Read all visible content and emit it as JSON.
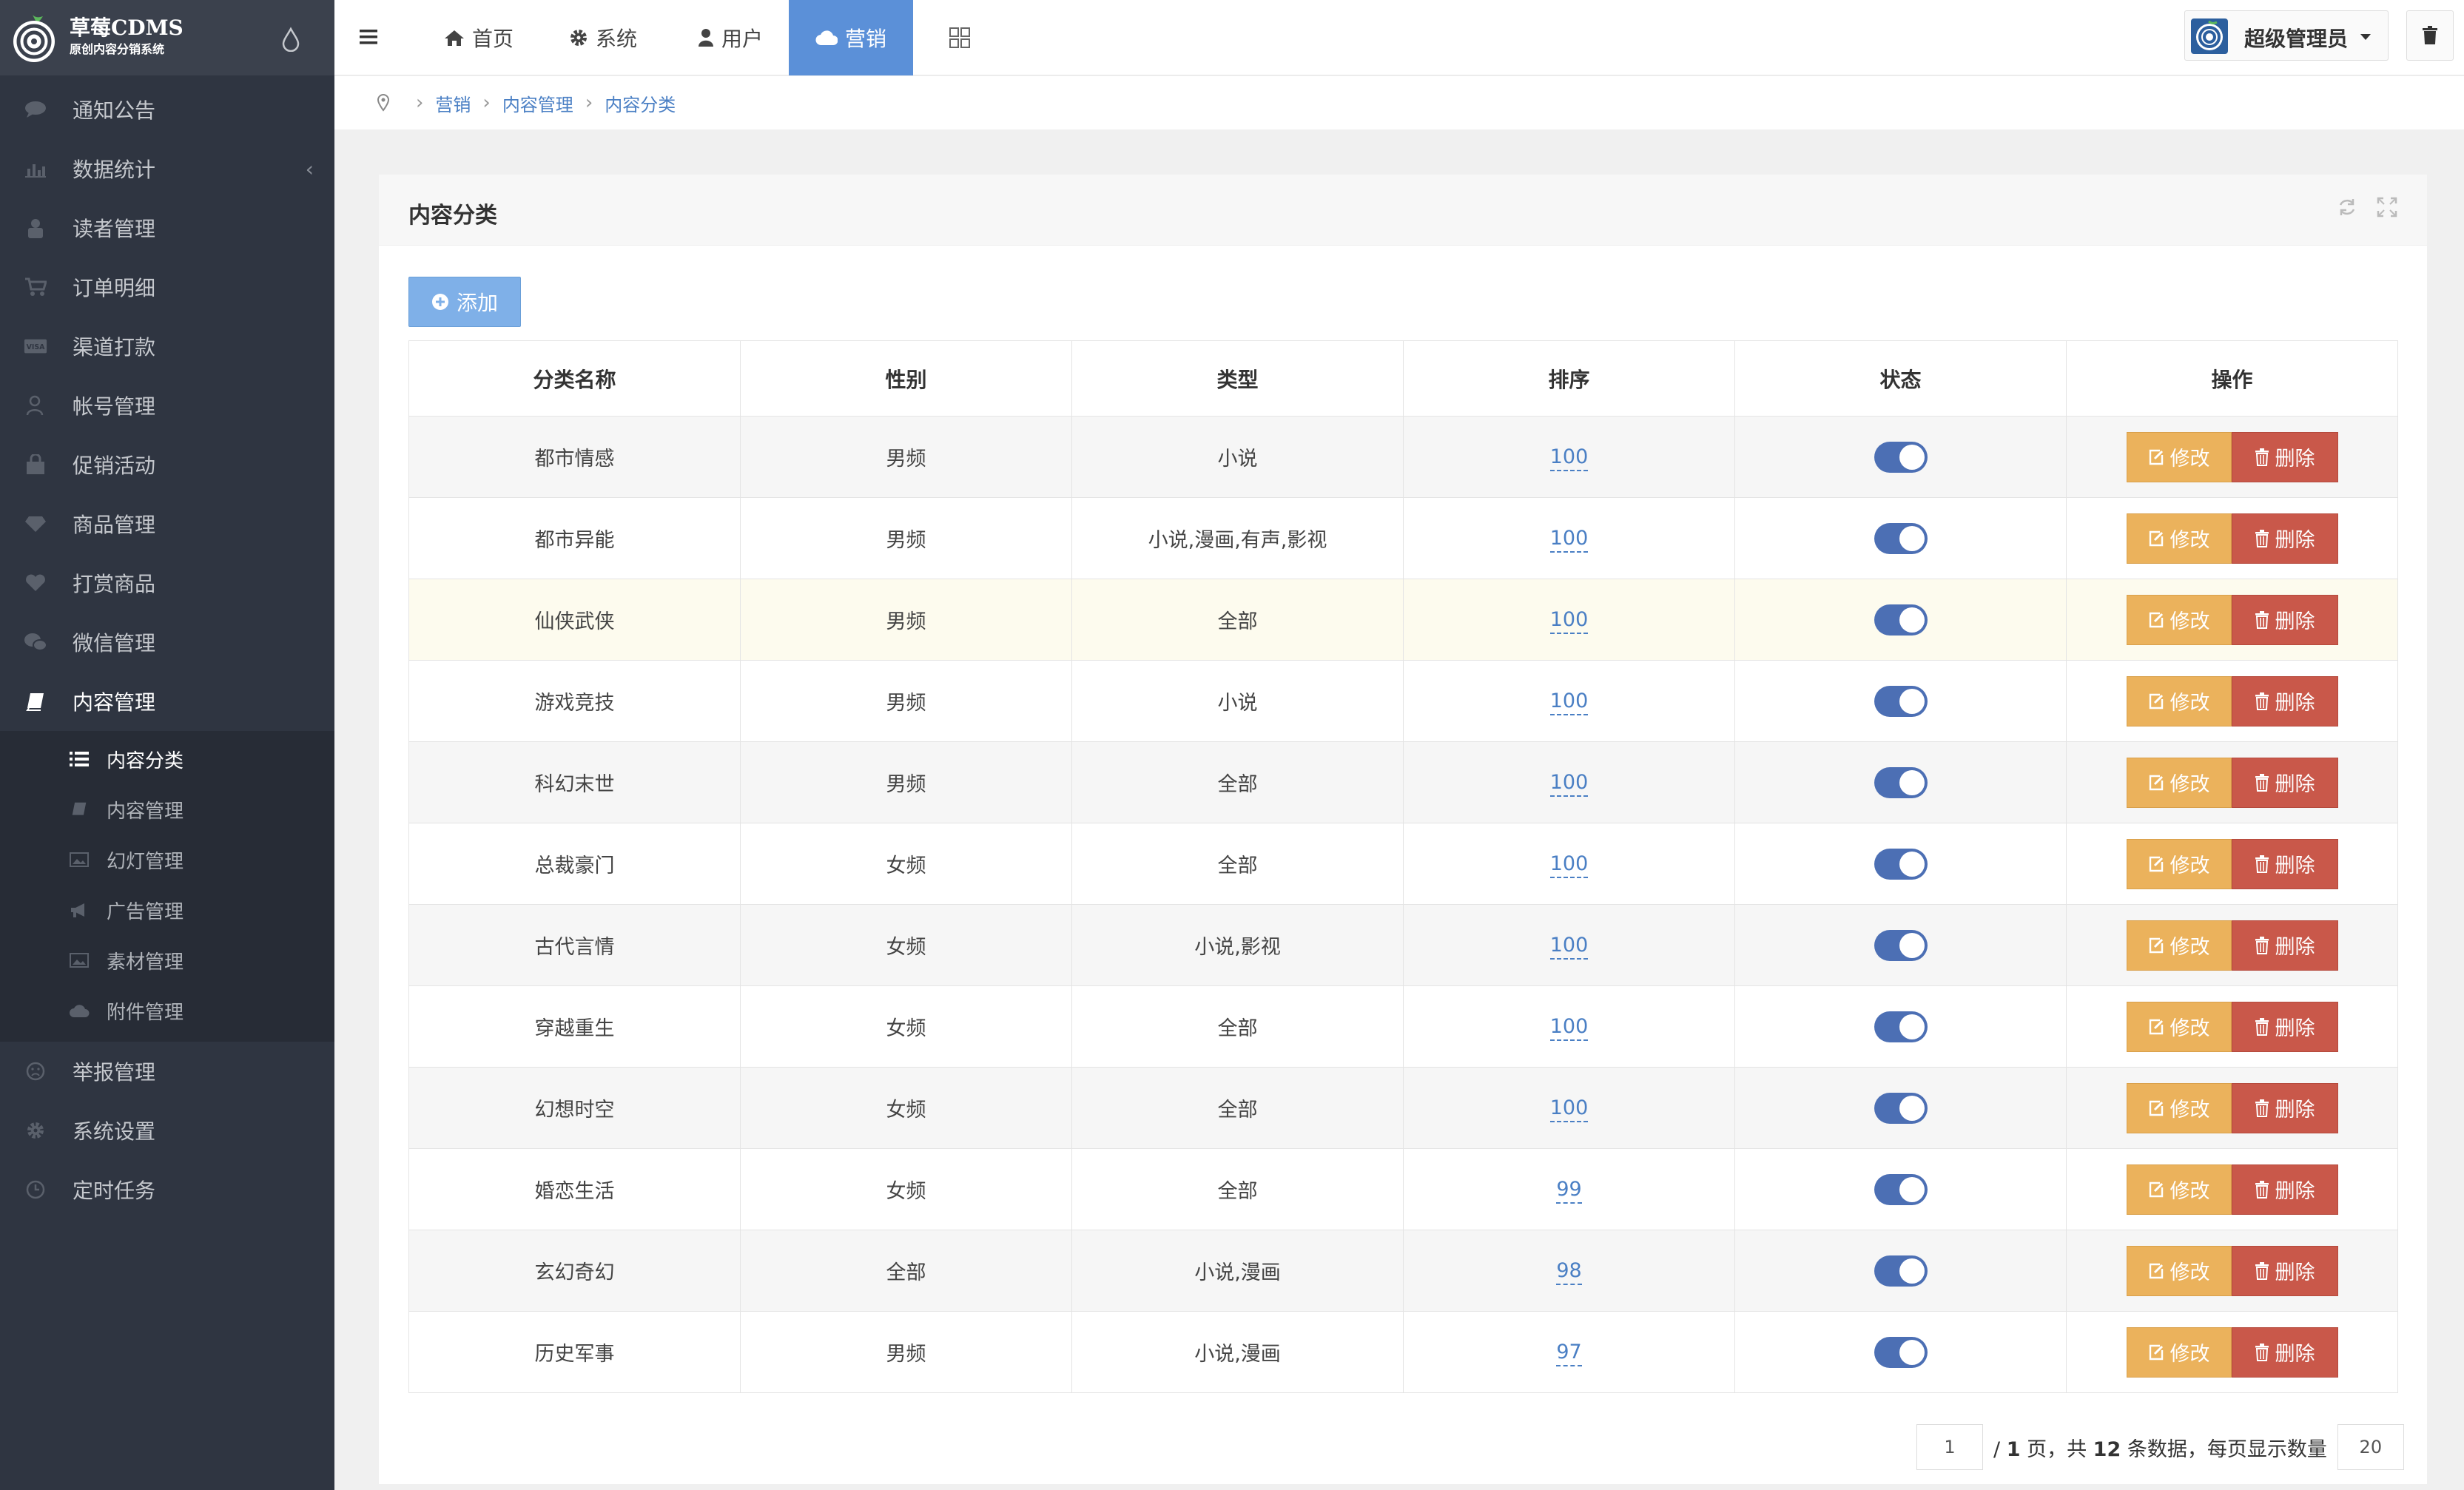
{
  "app": {
    "logo_title": "草莓CDMS",
    "logo_subtitle": "原创内容分销系统"
  },
  "sidebar": {
    "items": [
      {
        "label": "通知公告",
        "icon": "comment-icon"
      },
      {
        "label": "数据统计",
        "icon": "bar-chart-icon",
        "arrow": "‹"
      },
      {
        "label": "读者管理",
        "icon": "user-lock-icon"
      },
      {
        "label": "订单明细",
        "icon": "cart-icon"
      },
      {
        "label": "渠道打款",
        "icon": "visa-card-icon"
      },
      {
        "label": "帐号管理",
        "icon": "user-icon"
      },
      {
        "label": "促销活动",
        "icon": "bag-icon"
      },
      {
        "label": "商品管理",
        "icon": "diamond-icon"
      },
      {
        "label": "打赏商品",
        "icon": "heart-icon"
      },
      {
        "label": "微信管理",
        "icon": "wechat-icon"
      },
      {
        "label": "内容管理",
        "icon": "book-icon"
      }
    ],
    "sub_items": [
      {
        "label": "内容分类",
        "icon": "list-icon"
      },
      {
        "label": "内容管理",
        "icon": "book-icon"
      },
      {
        "label": "幻灯管理",
        "icon": "image-icon"
      },
      {
        "label": "广告管理",
        "icon": "bullhorn-icon"
      },
      {
        "label": "素材管理",
        "icon": "image-icon"
      },
      {
        "label": "附件管理",
        "icon": "cloud-upload-icon"
      }
    ],
    "bottom_items": [
      {
        "label": "举报管理",
        "icon": "frown-icon"
      },
      {
        "label": "系统设置",
        "icon": "gear-icon"
      },
      {
        "label": "定时任务",
        "icon": "clock-icon"
      }
    ]
  },
  "topnav": {
    "tabs": [
      {
        "label": "首页",
        "icon": "home-icon"
      },
      {
        "label": "系统",
        "icon": "gear-icon"
      },
      {
        "label": "用户",
        "icon": "user-icon"
      },
      {
        "label": "营销",
        "icon": "cloud-icon",
        "active": true
      }
    ],
    "admin_name": "超级管理员"
  },
  "breadcrumb": [
    "营销",
    "内容管理",
    "内容分类"
  ],
  "panel": {
    "title": "内容分类",
    "add_label": "添加"
  },
  "table": {
    "columns": [
      "分类名称",
      "性别",
      "类型",
      "排序",
      "状态",
      "操作"
    ],
    "edit_label": "修改",
    "delete_label": "删除",
    "rows": [
      {
        "name": "都市情感",
        "gender": "男频",
        "type": "小说",
        "sort": "100",
        "enabled": true
      },
      {
        "name": "都市异能",
        "gender": "男频",
        "type": "小说,漫画,有声,影视",
        "sort": "100",
        "enabled": true
      },
      {
        "name": "仙侠武侠",
        "gender": "男频",
        "type": "全部",
        "sort": "100",
        "enabled": true
      },
      {
        "name": "游戏竞技",
        "gender": "男频",
        "type": "小说",
        "sort": "100",
        "enabled": true
      },
      {
        "name": "科幻末世",
        "gender": "男频",
        "type": "全部",
        "sort": "100",
        "enabled": true
      },
      {
        "name": "总裁豪门",
        "gender": "女频",
        "type": "全部",
        "sort": "100",
        "enabled": true
      },
      {
        "name": "古代言情",
        "gender": "女频",
        "type": "小说,影视",
        "sort": "100",
        "enabled": true
      },
      {
        "name": "穿越重生",
        "gender": "女频",
        "type": "全部",
        "sort": "100",
        "enabled": true
      },
      {
        "name": "幻想时空",
        "gender": "女频",
        "type": "全部",
        "sort": "100",
        "enabled": true
      },
      {
        "name": "婚恋生活",
        "gender": "女频",
        "type": "全部",
        "sort": "99",
        "enabled": true
      },
      {
        "name": "玄幻奇幻",
        "gender": "全部",
        "type": "小说,漫画",
        "sort": "98",
        "enabled": true
      },
      {
        "name": "历史军事",
        "gender": "男频",
        "type": "小说,漫画",
        "sort": "97",
        "enabled": true
      }
    ]
  },
  "pager": {
    "current_page": "1",
    "text_prefix": "/ ",
    "total_pages": "1",
    "text_mid1": " 页，共 ",
    "total_records": "12",
    "text_mid2": " 条数据，每页显示数量",
    "page_size": "20"
  },
  "colors": {
    "sidebar_bg": "#2f3541",
    "accent": "#5b90d8",
    "edit_button": "#ebb25c",
    "delete_button": "#c9584a",
    "toggle_on": "#4c6fb4"
  }
}
